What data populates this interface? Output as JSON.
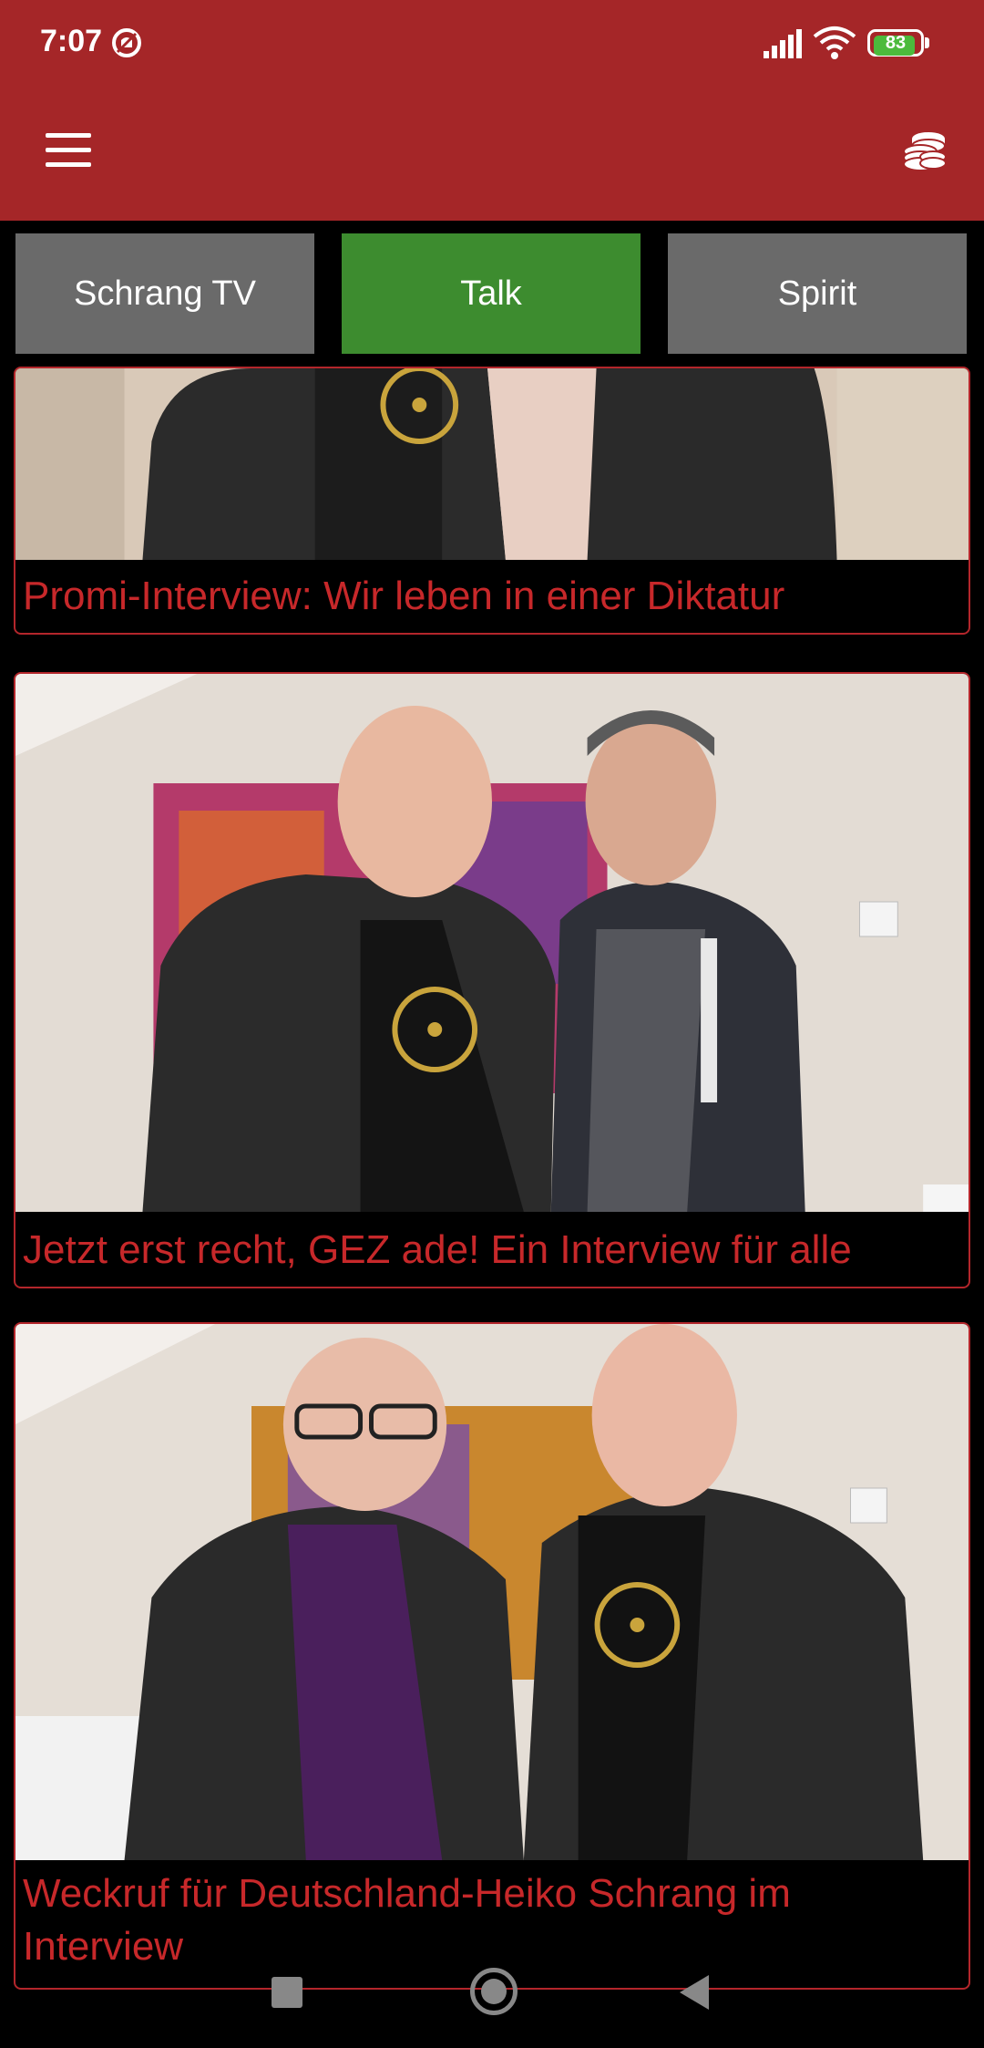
{
  "status_bar": {
    "time": "7:07",
    "battery_level": "83",
    "battery_fraction": 0.83,
    "icons": [
      "do-not-disturb-icon",
      "signal-icon",
      "wifi-icon",
      "battery-icon"
    ]
  },
  "app_bar": {
    "menu_icon": "menu-icon",
    "coins_icon": "coins-stack-icon"
  },
  "tabs": [
    {
      "label": "Schrang TV",
      "active": false
    },
    {
      "label": "Talk",
      "active": true
    },
    {
      "label": "Spirit",
      "active": false
    }
  ],
  "colors": {
    "header": "#a52628",
    "tab_active": "#3d8c2f",
    "tab_inactive": "#6a6a6a",
    "title_red": "#c7282a",
    "background": "#000000"
  },
  "feed": {
    "items": [
      {
        "title": "Promi-Interview: Wir leben in einer Diktatur"
      },
      {
        "title": "Jetzt erst recht, GEZ ade! Ein Interview für alle"
      },
      {
        "title": "Weckruf für Deutschland-Heiko Schrang im Interview"
      }
    ]
  },
  "nav_bar": {
    "icons": [
      "recents-icon",
      "home-icon",
      "back-icon"
    ]
  }
}
